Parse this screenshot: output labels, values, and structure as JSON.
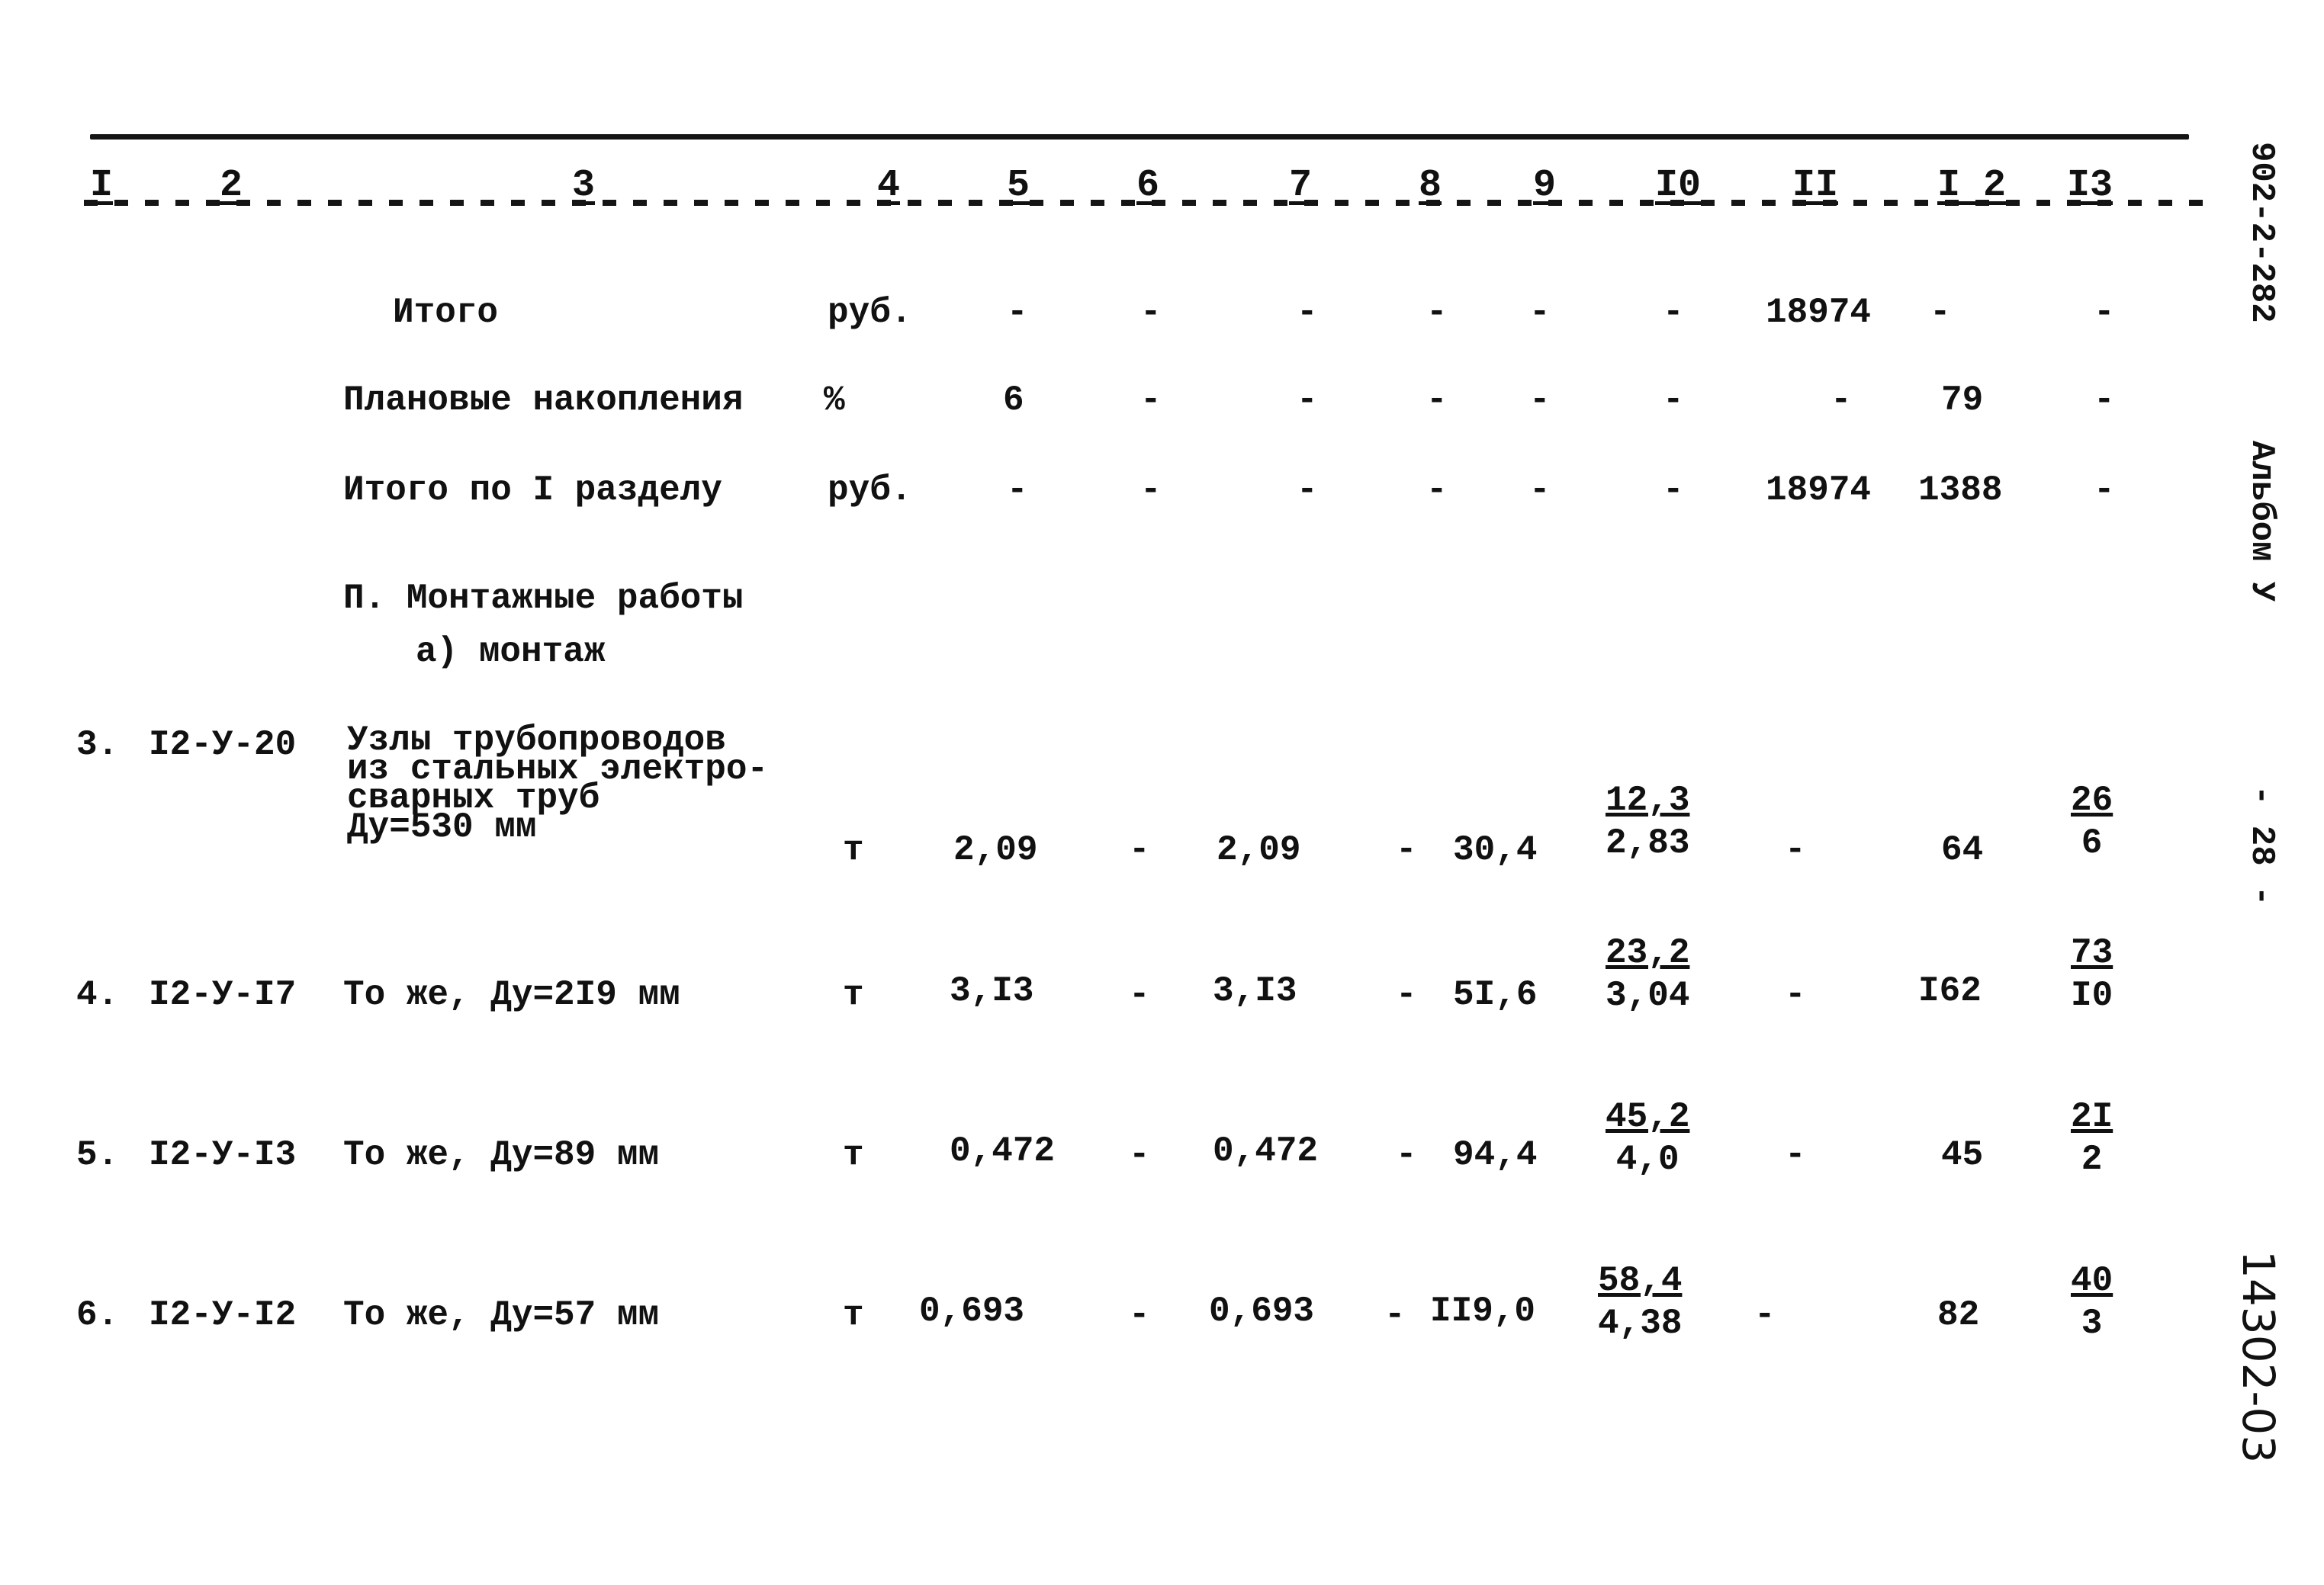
{
  "document": {
    "column_numbers": [
      "I",
      "2",
      "3",
      "4",
      "5",
      "6",
      "7",
      "8",
      "9",
      "I0",
      "II",
      "I 2",
      "I3"
    ],
    "margin": {
      "code": "902-2-282",
      "album": "Альбом У",
      "page_number": "- 28 -",
      "inventory": "14302-03"
    },
    "summary_rows": [
      {
        "label": "Итого",
        "unit": "руб.",
        "c5": "-",
        "c6": "-",
        "c7": "-",
        "c8": "-",
        "c9": "-",
        "c10": "-",
        "c11": "18974",
        "c12": "-",
        "c13": "-"
      },
      {
        "label": "Плановые накопления",
        "unit": "%",
        "c5": "6",
        "c6": "-",
        "c7": "-",
        "c8": "-",
        "c9": "-",
        "c10": "-",
        "c11": "-",
        "c12": "79",
        "c13": "-"
      },
      {
        "label": "Итого по I разделу",
        "unit": "руб.",
        "c5": "-",
        "c6": "-",
        "c7": "-",
        "c8": "-",
        "c9": "-",
        "c10": "-",
        "c11": "18974",
        "c12": "1388",
        "c13": "-"
      }
    ],
    "section": {
      "title": "П. Монтажные работы",
      "subtitle": "а) монтаж"
    },
    "items": [
      {
        "num": "3.",
        "code": "I2-У-20",
        "description": "Узлы трубопроводов\nиз стальных электро-\nсварных труб\nДу=530 мм",
        "unit": "т",
        "c5": "2,09",
        "c6": "-",
        "c7": "2,09",
        "c8": "-",
        "c9": "30,4",
        "c10_num": "12,3",
        "c10_den": "2,83",
        "c11": "-",
        "c12": "64",
        "c13_num": "26",
        "c13_den": "6"
      },
      {
        "num": "4.",
        "code": "I2-У-I7",
        "description": "То же, Ду=2I9 мм",
        "unit": "т",
        "c5": "3,I3",
        "c6": "-",
        "c7": "3,I3",
        "c8": "-",
        "c9": "5I,6",
        "c10_num": "23,2",
        "c10_den": "3,04",
        "c11": "-",
        "c12": "I62",
        "c13_num": "73",
        "c13_den": "I0"
      },
      {
        "num": "5.",
        "code": "I2-У-I3",
        "description": "То же, Ду=89 мм",
        "unit": "т",
        "c5": "0,472",
        "c6": "-",
        "c7": "0,472",
        "c8": "-",
        "c9": "94,4",
        "c10_num": "45,2",
        "c10_den": "4,0",
        "c11": "-",
        "c12": "45",
        "c13_num": "2I",
        "c13_den": "2"
      },
      {
        "num": "6.",
        "code": "I2-У-I2",
        "description": "То же, Ду=57 мм",
        "unit": "т",
        "c5": "0,693",
        "c6": "-",
        "c7": "0,693",
        "c8": "-",
        "c9": "II9,0",
        "c10_num": "58,4",
        "c10_den": "4,38",
        "c11": "-",
        "c12": "82",
        "c13_num": "40",
        "c13_den": "3"
      }
    ]
  }
}
